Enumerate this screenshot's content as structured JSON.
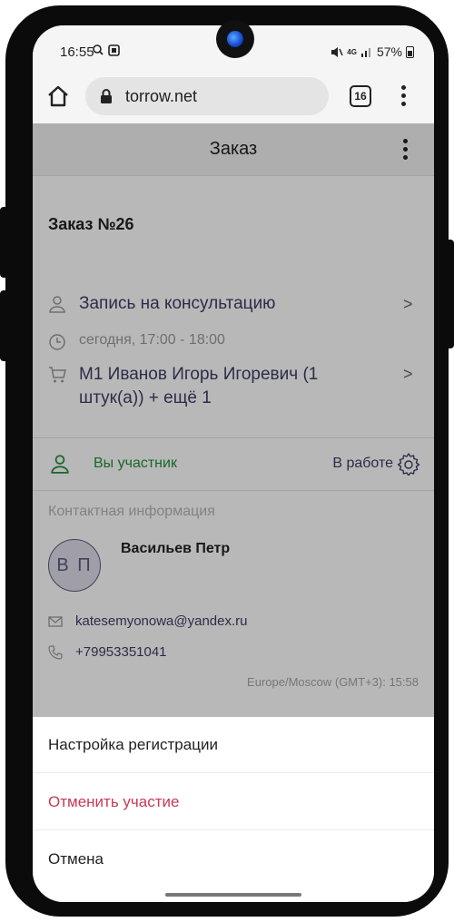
{
  "status_bar": {
    "time": "16:55",
    "network": "4G",
    "battery": "57%"
  },
  "browser": {
    "url": "torrow.net",
    "tab_count": "16"
  },
  "app": {
    "header_title": "Заказ",
    "order_title": "Заказ №26",
    "service": "Запись на консультацию",
    "time_slot": "сегодня, 17:00 - 18:00",
    "items": "М1 Иванов Игорь Игоревич (1 штук(а)) + ещё 1",
    "participant_label": "Вы участник",
    "participant_status": "В работе",
    "contact_section_label": "Контактная информация",
    "contact": {
      "avatar_initials": "В П",
      "name": "Васильев Петр",
      "email": "katesemyonowa@yandex.ru",
      "phone": "+79953351041",
      "timezone": "Europe/Moscow (GMT+3): 15:58"
    }
  },
  "sheet": {
    "items": [
      {
        "label": "Настройка регистрации"
      },
      {
        "label": "Отменить участие"
      },
      {
        "label": "Отмена"
      }
    ]
  },
  "colors": {
    "accent_text": "#3d3d66",
    "participant_green": "#1f8f3a",
    "danger_red": "#c83a55"
  }
}
